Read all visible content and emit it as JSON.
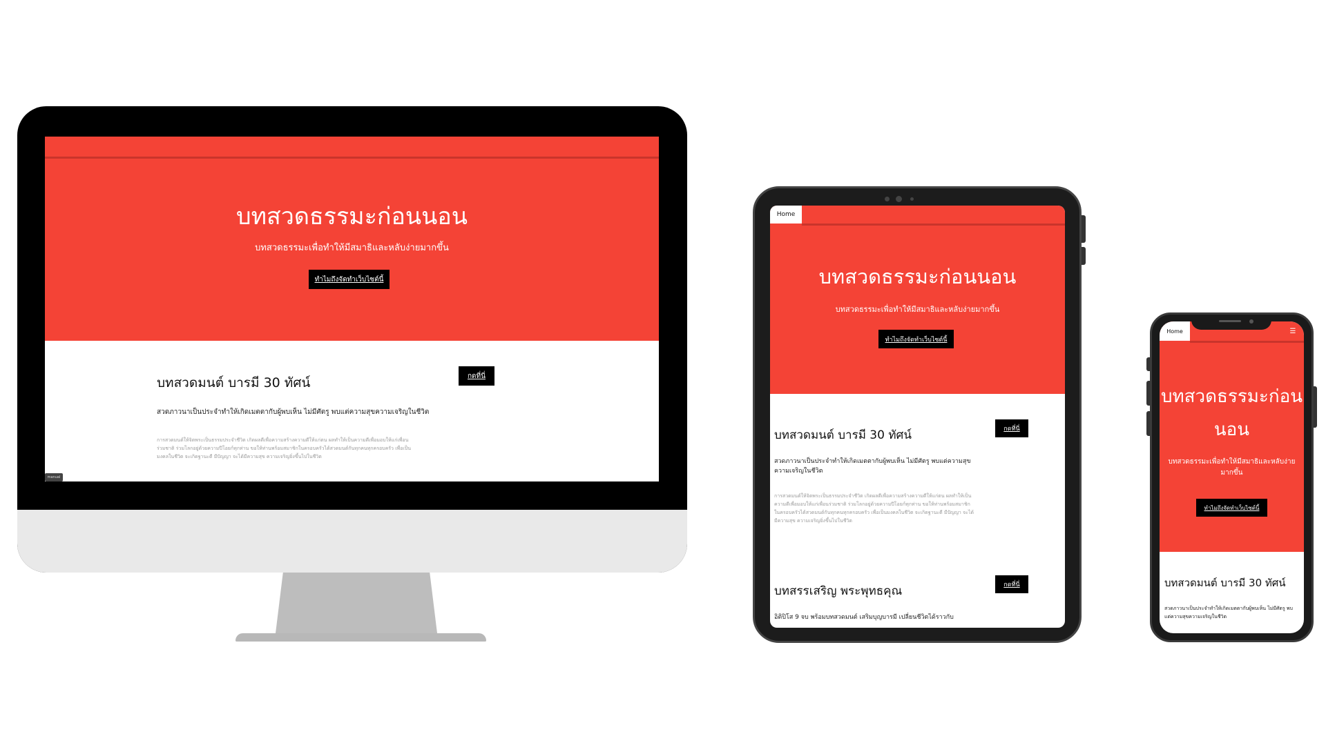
{
  "colors": {
    "accent": "#f44336",
    "accent_dark": "#c9342b",
    "button": "#000000"
  },
  "hero": {
    "title": "บทสวดธรรมะก่อนนอน",
    "subtitle": "บทสวดธรรมะเพื่อทำให้มีสมาธิและหลับง่ายมากขึ้น",
    "cta_label": "ทำไมถึงจัดทำเว็บไซต์นี้"
  },
  "nav": {
    "home_label": "Home",
    "menu_icon": "hamburger-icon"
  },
  "cards": [
    {
      "title": "บทสวดมนต์ บารมี 30 ทัศน์",
      "button_label": "กดที่นี่",
      "lead": "สวดภาวนาเป็นประจำทำให้เกิดเมตตากับผู้พบเห็น ไม่มีศัตรู พบแต่ความสุขความเจริญในชีวิต",
      "body": "การสวดมนต์ให้จิตพระเป็นธรรมประจำชีวิต เกิดผลดีเพื่อความสร้างความดีให้แก่ตน ผลทำให้เป็นความดีเพื่อมอบให้แก่เพื่อนร่วมชาติ ร่วมโลกอยู่ด้วยความปีโอยก์ทุกท่าน ขอให้ท่านพร้อมสมาชิกในครอบครัวได้สวดมนต์กันทุกคนทุกครอบครัว เพื่อเป็นมงคลในชีวิต จะเกิดฐานะดี มีปัญญา จะได้มีความสุข ความเจริญยิ่งขึ้นไปในชีวิต"
    },
    {
      "title": "บทสรรเสริญ พระพุทธคุณ",
      "button_label": "กดที่นี่",
      "lead": "อิติปิโส 9 จบ พร้อมบทสวดมนต์ เสริมบุญบารมี เปลี่ยนชีวิตได้ราวกับ"
    }
  ],
  "desktop_badge": "manual"
}
